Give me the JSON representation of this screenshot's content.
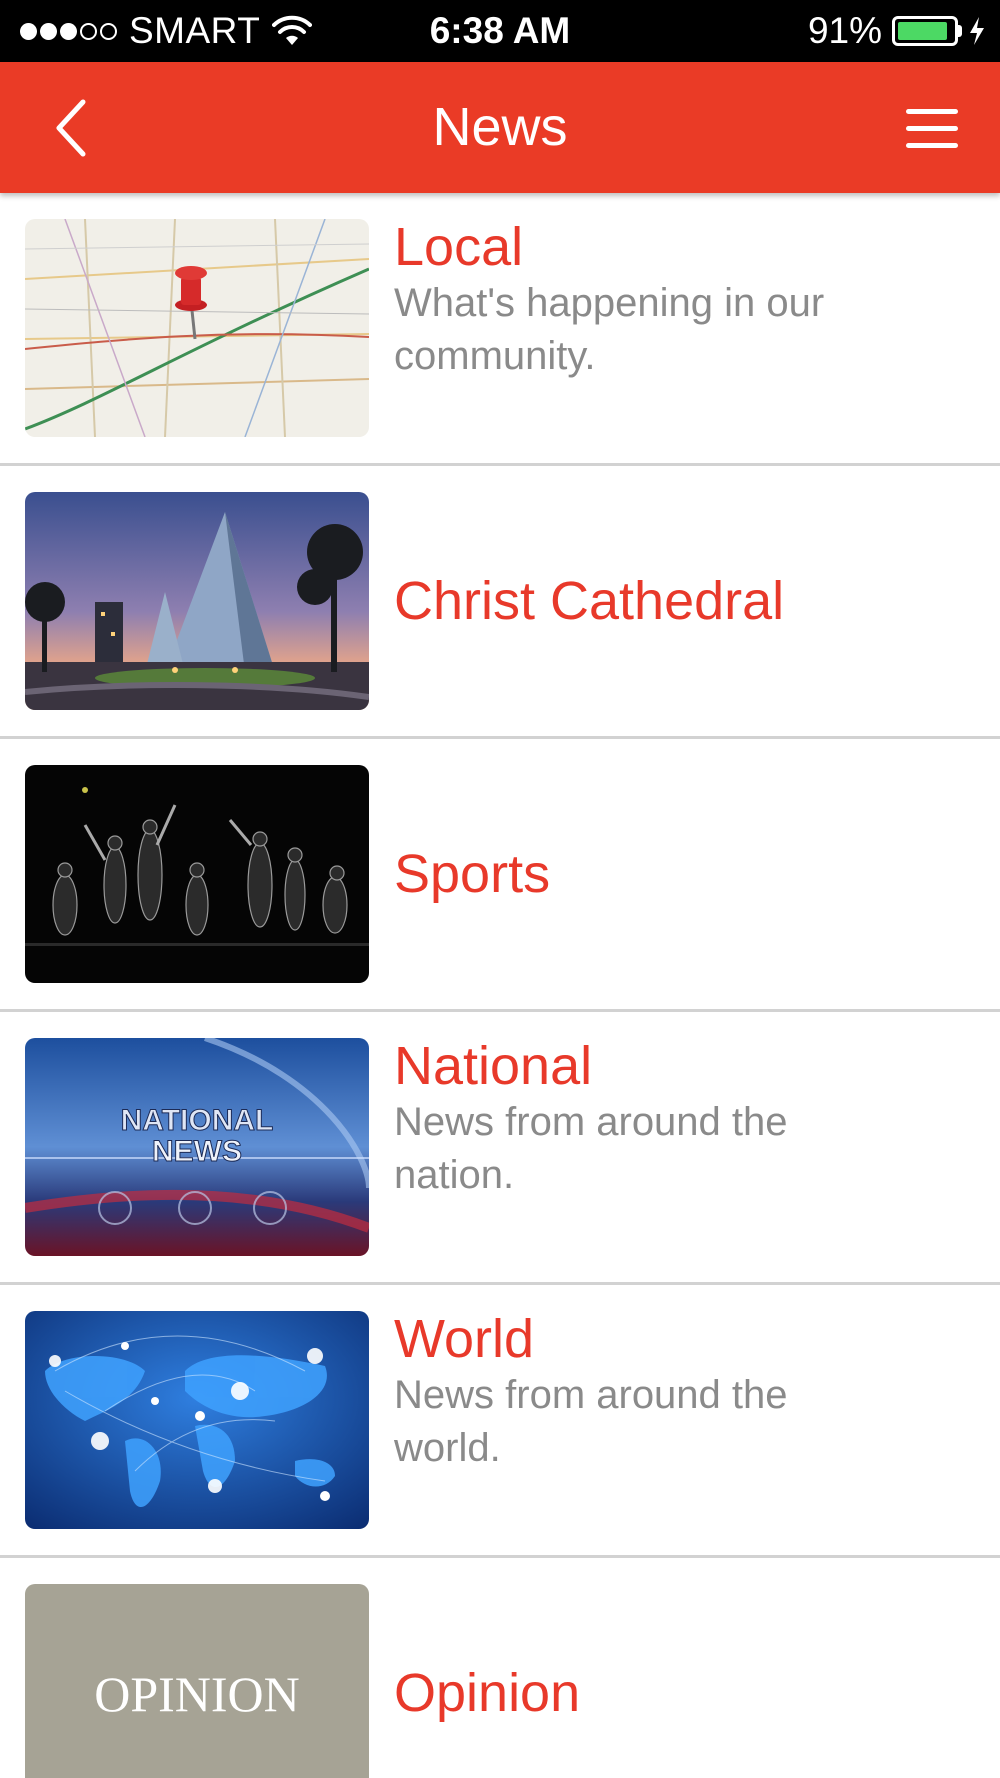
{
  "status_bar": {
    "carrier": "SMART",
    "time": "6:38 AM",
    "battery_percent": "91%",
    "battery_level": 0.91,
    "signal_bars_filled": 3,
    "signal_bars_total": 5,
    "battery_color": "#4cd964"
  },
  "nav": {
    "title": "News",
    "back_icon": "chevron-left-icon",
    "menu_icon": "hamburger-menu-icon",
    "background_color": "#ea3b26"
  },
  "items": [
    {
      "title": "Local",
      "description": "What's happening in our community.",
      "image": "map-with-red-pushpin"
    },
    {
      "title": "Christ Cathedral",
      "description": "",
      "image": "glass-cathedral-at-dusk"
    },
    {
      "title": "Sports",
      "description": "",
      "image": "athlete-silhouettes-on-black"
    },
    {
      "title": "National",
      "description": "News from around the nation.",
      "image": "national-news-graphic",
      "image_text_line1": "NATIONAL",
      "image_text_line2": "NEWS"
    },
    {
      "title": "World",
      "description": "News from around the world.",
      "image": "glowing-world-map"
    },
    {
      "title": "Opinion",
      "description": "",
      "image": "opinion-text-tile",
      "image_text": "OPINION"
    }
  ],
  "colors": {
    "accent": "#ea3b26",
    "title_text": "#e8392a",
    "description_text": "#8a8a8a",
    "divider": "#d2d2d2"
  }
}
